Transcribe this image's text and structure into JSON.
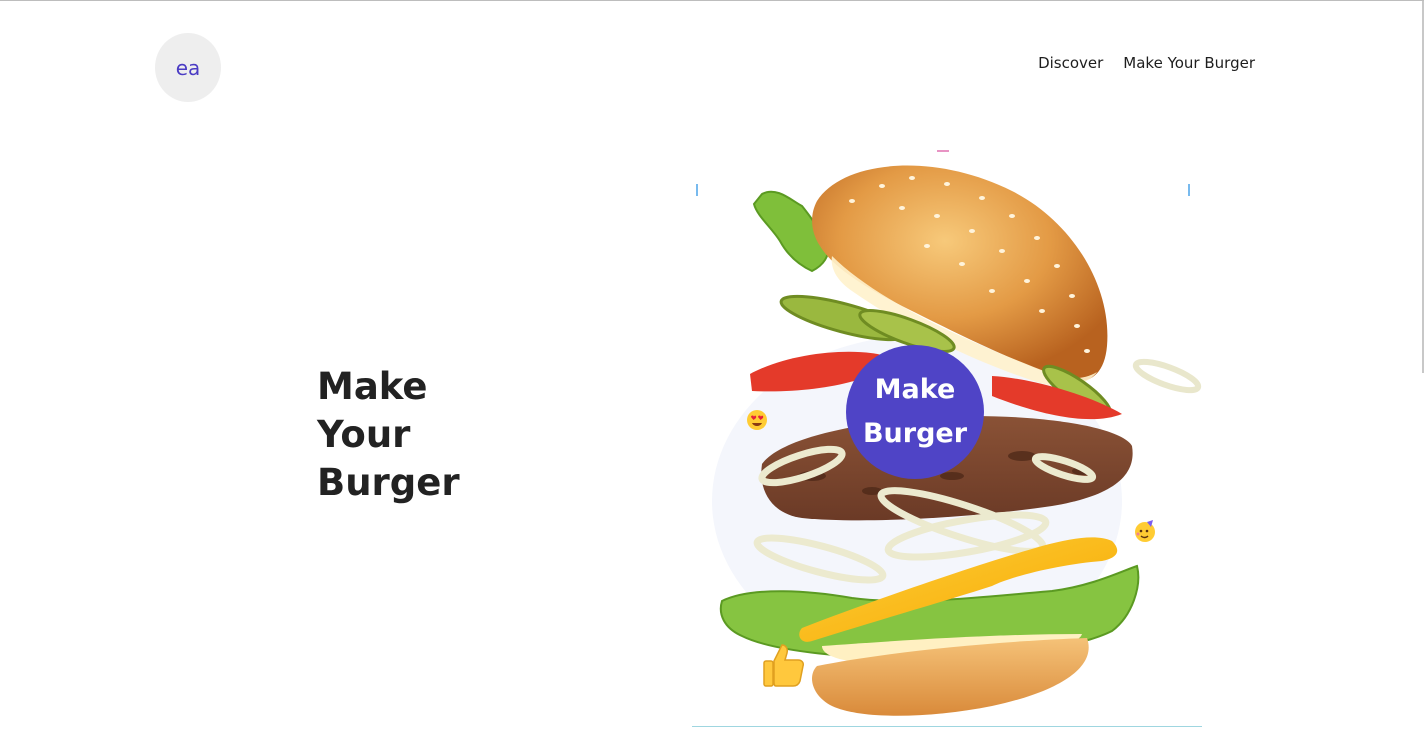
{
  "header": {
    "logo_text": "ea",
    "nav": [
      {
        "label": "Discover"
      },
      {
        "label": "Make Your Burger"
      }
    ]
  },
  "hero": {
    "title_lines": [
      "Make",
      "Your",
      "Burger"
    ]
  },
  "cta": {
    "line1": "Make",
    "line2": "Burger"
  },
  "colors": {
    "accent": "#4f44c6",
    "logo_bg": "#eeeeee",
    "logo_text": "#4b3cc4",
    "text": "#222222"
  },
  "icons": [
    "heart-eyes-emoji-icon",
    "party-face-emoji-icon",
    "thumbs-up-emoji-icon"
  ]
}
